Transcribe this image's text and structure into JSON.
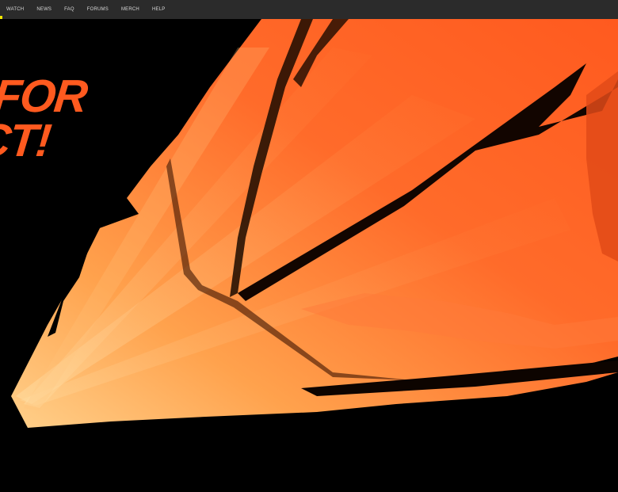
{
  "nav": {
    "items": [
      {
        "label": "WATCH"
      },
      {
        "label": "NEWS"
      },
      {
        "label": "FAQ"
      },
      {
        "label": "FORUMS"
      },
      {
        "label": "MERCH"
      },
      {
        "label": "HELP"
      }
    ]
  },
  "hero": {
    "headline_line1": "FOR",
    "headline_line2": "CT!"
  },
  "colors": {
    "nav_bg": "#2b2b2b",
    "accent_yellow": "#f2e600",
    "orange_main": "#ff5a1f",
    "orange_light": "#ffb060",
    "background": "#000000"
  }
}
